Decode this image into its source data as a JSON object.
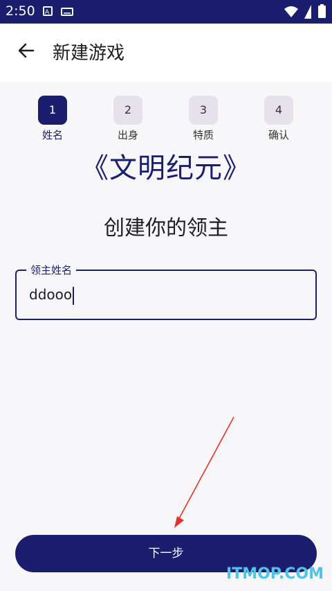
{
  "status_bar": {
    "time": "2:50",
    "icons": [
      "notification-a-icon",
      "keyboard-icon",
      "wifi-icon",
      "battery-icon"
    ]
  },
  "app_bar": {
    "back_icon": "arrow-left-icon",
    "title": "新建游戏"
  },
  "steps": [
    {
      "number": "1",
      "label": "姓名",
      "active": true
    },
    {
      "number": "2",
      "label": "出身",
      "active": false
    },
    {
      "number": "3",
      "label": "特质",
      "active": false
    },
    {
      "number": "4",
      "label": "确认",
      "active": false
    }
  ],
  "game_title": "《文明纪元》",
  "subtitle": "创建你的领主",
  "lord_name_field": {
    "label": "领主姓名",
    "value": "ddooo"
  },
  "next_button": {
    "label": "下一步"
  },
  "watermark": "ITMOP.COM",
  "colors": {
    "primary": "#1b1e6f",
    "step_inactive": "#e6e1ea",
    "background": "#f7f7f9",
    "annotation_arrow": "#e8302a",
    "watermark": "#4fc3e8"
  }
}
